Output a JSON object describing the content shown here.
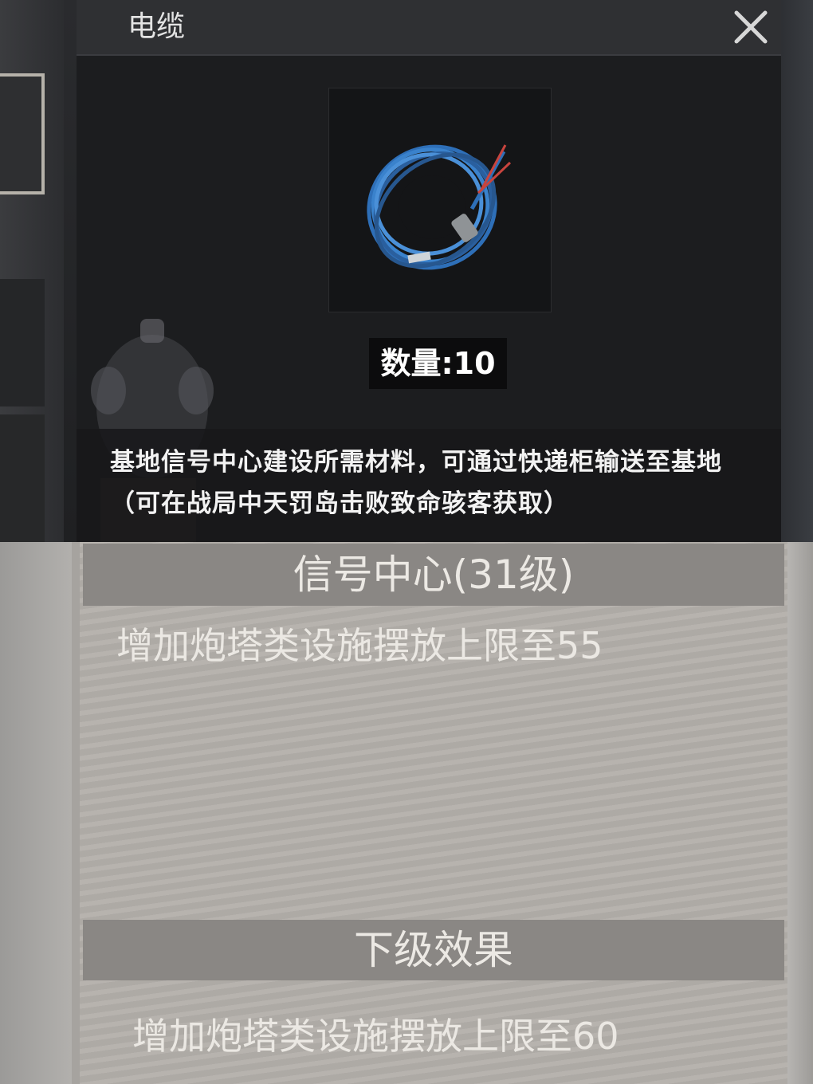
{
  "item": {
    "title": "电缆",
    "quantity_text": "数量:10",
    "description": "基地信号中心建设所需材料，可通过快递柜输送至基地（可在战局中天罚岛击败致命骇客获取）",
    "icon": "cable-icon",
    "icon_color": "#2e6fb8"
  },
  "building": {
    "current_header": "信号中心(31级)",
    "current_effect": "增加炮塔类设施摆放上限至55",
    "next_header": "下级效果",
    "next_effect": "增加炮塔类设施摆放上限至60"
  }
}
